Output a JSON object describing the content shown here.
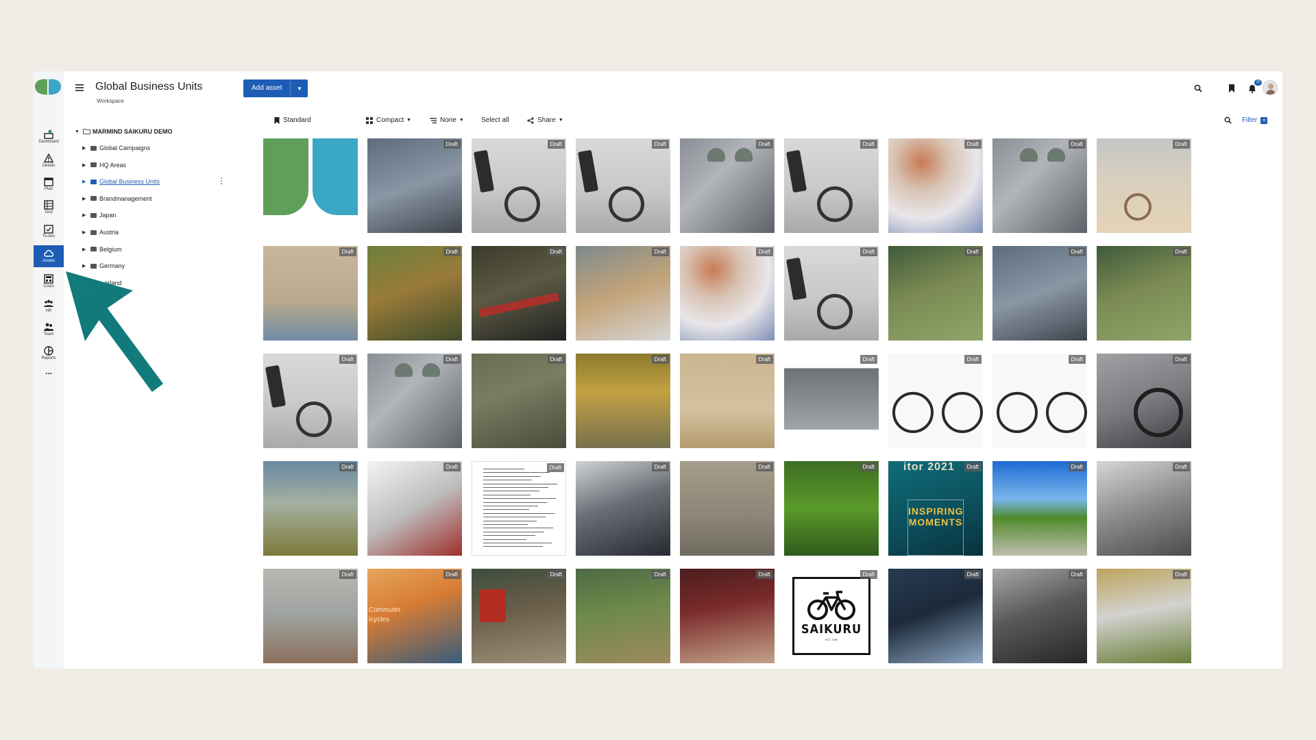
{
  "app": {
    "workspace_title": "Global Business Units",
    "workspace_subtitle": "Workspace"
  },
  "colors": {
    "accent": "#1d5db5",
    "arrow": "#127a7a",
    "logo_green": "#5f9f5a",
    "logo_teal": "#3aa7c4"
  },
  "rail": {
    "items": [
      {
        "label": "Dashboard",
        "icon": "dashboard-icon"
      },
      {
        "label": "Details",
        "icon": "warning-icon"
      },
      {
        "label": "Plan",
        "icon": "calendar-icon"
      },
      {
        "label": "Grid",
        "icon": "grid-icon"
      },
      {
        "label": "To-dos",
        "icon": "todo-icon"
      },
      {
        "label": "Assets",
        "icon": "cloud-icon",
        "active": true
      },
      {
        "label": "Costs",
        "icon": "costs-icon"
      },
      {
        "label": "HR",
        "icon": "people-icon"
      },
      {
        "label": "Team",
        "icon": "team-icon"
      },
      {
        "label": "Reports",
        "icon": "reports-icon"
      }
    ],
    "more": "..."
  },
  "tree": {
    "root": "MARMIND SAIKURU DEMO",
    "items": [
      {
        "label": "Global Campaigns"
      },
      {
        "label": "HQ Areas"
      },
      {
        "label": "Global Business Units",
        "selected": true
      },
      {
        "label": "Brandmanagement"
      },
      {
        "label": "Japan"
      },
      {
        "label": "Austria"
      },
      {
        "label": "Belgium"
      },
      {
        "label": "Germany"
      },
      {
        "label": "...erland"
      }
    ]
  },
  "header": {
    "add_asset_label": "Add asset",
    "notifications_badge": "10"
  },
  "toolbar": {
    "view": "Standard",
    "layout": "Compact",
    "group": "None",
    "select_all": "Select all",
    "share": "Share",
    "filter": "Filter"
  },
  "assets": {
    "draft_label": "Draft",
    "tiles": [
      "t-logo",
      "t-hands",
      "t-bike1",
      "t-bike1",
      "t-couple",
      "t-bike1",
      "t-blur",
      "t-couple",
      "t-kid",
      "t-man-wall",
      "t-autumn",
      "t-redbike",
      "t-basket",
      "t-blur",
      "t-bike1",
      "t-garden",
      "t-hands",
      "t-garden",
      "t-bike1",
      "t-couple",
      "t-oldman",
      "t-trees",
      "t-woodbike",
      "t-kids2",
      "t-blackbike",
      "t-blackbike",
      "t-ebike",
      "t-citybike",
      "t-closeup",
      "t-doc",
      "t-commute",
      "t-fog",
      "t-forest",
      "t-inspire",
      "t-road",
      "t-parked",
      "t-street",
      "t-commuter",
      "t-panniers",
      "t-meadow",
      "t-tunnel",
      "t-saikuru",
      "t-gear",
      "t-dark",
      "t-autumn2"
    ],
    "inspire_top": "itor 2021",
    "inspire_text": "INSPIRING MOMENTS",
    "commuter_text": "Commuter icycles",
    "saikuru_name": "SAIKURU",
    "saikuru_est": "EST. 1999"
  }
}
